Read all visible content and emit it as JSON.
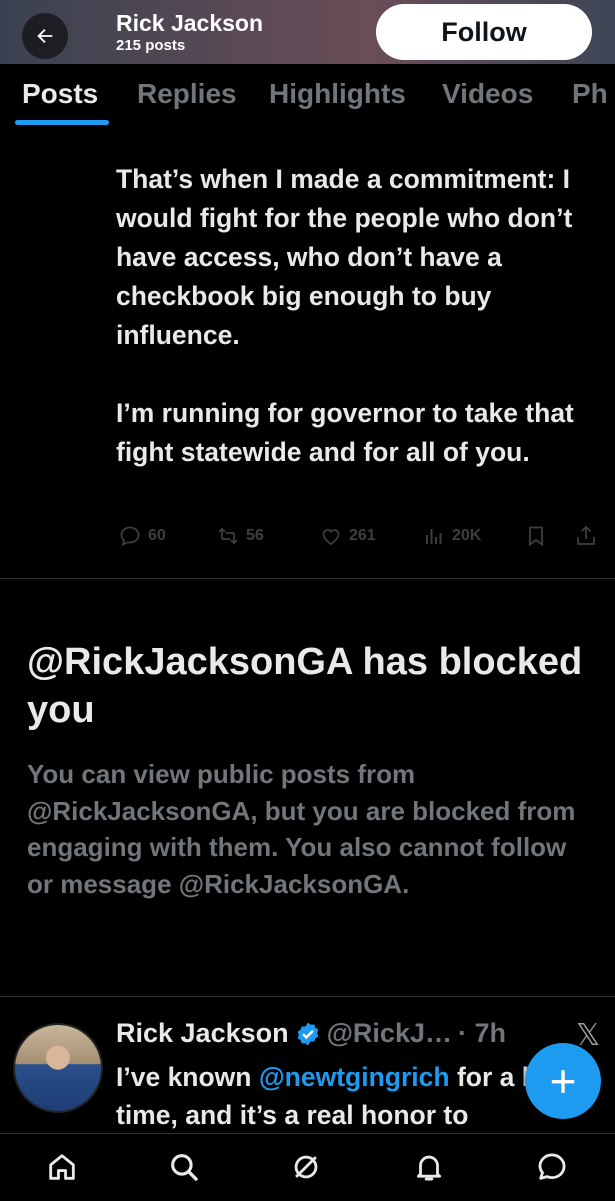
{
  "header": {
    "name": "Rick Jackson",
    "post_count": "215 posts",
    "follow_label": "Follow",
    "back_icon": "arrow-left-icon"
  },
  "tabs": [
    {
      "label": "Posts",
      "active": true
    },
    {
      "label": "Replies",
      "active": false
    },
    {
      "label": "Highlights",
      "active": false
    },
    {
      "label": "Videos",
      "active": false
    },
    {
      "label": "Ph",
      "active": false
    }
  ],
  "post": {
    "paragraph1": "That’s when I made a commitment: I would fight for the people who don’t have access, who don’t have a checkbook big enough to buy influence.",
    "paragraph2": "I’m running for governor to take that fight statewide and for all of you.",
    "replies": "60",
    "reposts": "56",
    "likes": "261",
    "views": "20K"
  },
  "blocked": {
    "title": "@RickJacksonGA has blocked you",
    "description": "You can view public posts from @RickJacksonGA, but you are blocked from engaging with them. You also cannot follow or message @RickJacksonGA."
  },
  "next_post": {
    "name": "Rick Jackson",
    "handle": "@RickJ…",
    "time": "· 7h",
    "text_before": "I’ve known ",
    "mention": "@newtgingrich",
    "text_after": " for a long time, and it’s a real honor to"
  },
  "fab_label": "+",
  "nav": [
    "home-icon",
    "search-icon",
    "grok-icon",
    "notifications-icon",
    "messages-icon"
  ],
  "colors": {
    "accent": "#1d9bf0",
    "background": "#000000",
    "muted": "#71767b"
  }
}
